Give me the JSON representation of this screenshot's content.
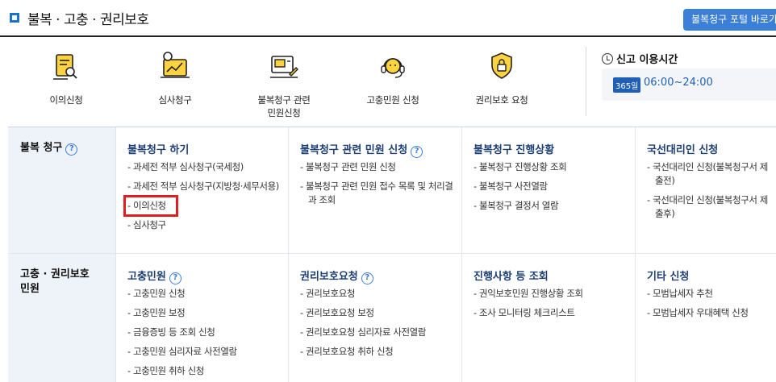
{
  "header": {
    "title": "불복 · 고충 · 권리보호",
    "portal_button": "불복청구 포털 바로가기",
    "accent": "#1a73c8"
  },
  "quick_icons": [
    {
      "label": "이의신청",
      "icon": "document-search-icon"
    },
    {
      "label": "심사청구",
      "icon": "chart-review-icon"
    },
    {
      "label": "불복청구 관련\n민원신청",
      "icon": "form-edit-icon"
    },
    {
      "label": "고충민원 신청",
      "icon": "headset-icon"
    },
    {
      "label": "권리보호 요청",
      "icon": "shield-lock-icon"
    }
  ],
  "hours": {
    "title": "신고 이용시간",
    "badge": "365일",
    "time": "06:00~24:00"
  },
  "sections": [
    {
      "head": "불복 청구",
      "columns": [
        {
          "title": "불복청구 하기",
          "items": [
            "과세전 적부 심사청구(국세청)",
            "과세전 적부 심사청구(지방청·세무서용)",
            "이의신청",
            "심사청구"
          ]
        },
        {
          "title": "불복청구 관련 민원 신청",
          "items": [
            "불복청구 관련 민원 신청",
            "불복청구 관련 민원 접수 목록 및 처리결과 조회"
          ]
        },
        {
          "title": "불복청구 진행상황",
          "items": [
            "불복청구 진행상황 조회",
            "불복청구 사전열람",
            "불복청구 결정서 열람"
          ]
        },
        {
          "title": "국선대리인 신청",
          "items": [
            "국선대리인 신청(불복청구서 제출전)",
            "국선대리인 신청(불복청구서 제출후)"
          ]
        }
      ]
    },
    {
      "head": "고충 · 권리보호 민원",
      "columns": [
        {
          "title": "고충민원",
          "items": [
            "고충민원 신청",
            "고충민원 보정",
            "금융증빙 등 조회 신청",
            "고충민원 심리자료 사전열람",
            "고충민원 취하 신청"
          ]
        },
        {
          "title": "권리보호요청",
          "items": [
            "권리보호요청",
            "권리보호요청 보정",
            "권리보호요청 심리자료 사전열람",
            "권리보호요청 취하 신청"
          ]
        },
        {
          "title": "진행사항 등 조회",
          "items": [
            "권익보호민원 진행상황 조회",
            "조사 모니터링 체크리스트"
          ]
        },
        {
          "title": "기타 신청",
          "items": [
            "모범납세자 추천",
            "모범납세자 우대혜택 신청"
          ]
        }
      ]
    }
  ],
  "help_symbol": "?",
  "highlighted_item": "이의신청"
}
